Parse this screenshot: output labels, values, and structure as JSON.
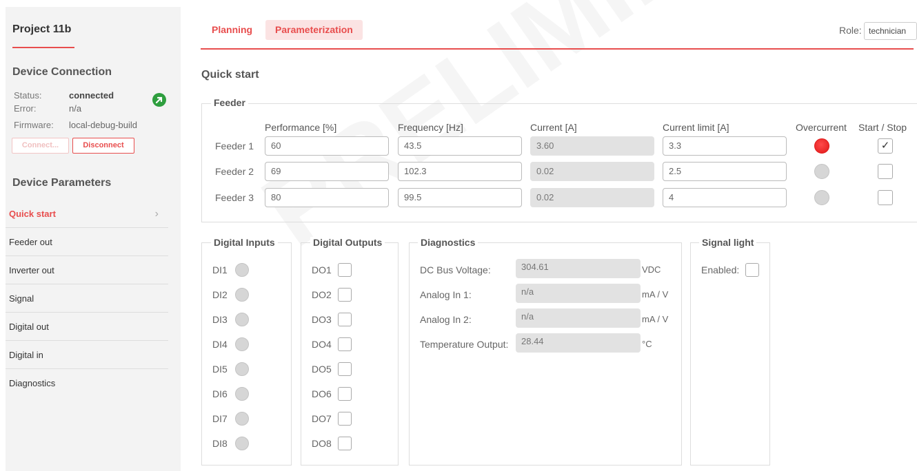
{
  "sidebar": {
    "project_title": "Project 11b",
    "connection": {
      "title": "Device Connection",
      "status_label": "Status:",
      "status_value": "connected",
      "error_label": "Error:",
      "error_value": "n/a",
      "firmware_label": "Firmware:",
      "firmware_value": "local-debug-build",
      "connect_label": "Connect...",
      "disconnect_label": "Disconnect",
      "status_color": "#2e9e3e"
    },
    "params_title": "Device Parameters",
    "items": [
      {
        "label": "Quick start"
      },
      {
        "label": "Feeder out"
      },
      {
        "label": "Inverter out"
      },
      {
        "label": "Signal"
      },
      {
        "label": "Digital out"
      },
      {
        "label": "Digital in"
      },
      {
        "label": "Diagnostics"
      }
    ]
  },
  "header": {
    "tabs": [
      {
        "label": "Planning"
      },
      {
        "label": "Parameterization"
      }
    ],
    "role_label": "Role:",
    "role_value": "technician"
  },
  "main": {
    "title": "Quick start",
    "feeder": {
      "legend": "Feeder",
      "columns": [
        "Performance [%]",
        "Frequency [Hz]",
        "Current [A]",
        "Current limit [A]",
        "Overcurrent",
        "Start / Stop"
      ],
      "rows": [
        {
          "label": "Feeder 1",
          "performance": "60",
          "frequency": "43.5",
          "current": "3.60",
          "limit": "3.3",
          "overcurrent": true,
          "running": true,
          "check": "✓"
        },
        {
          "label": "Feeder 2",
          "performance": "69",
          "frequency": "102.3",
          "current": "0.02",
          "limit": "2.5",
          "overcurrent": false,
          "running": false,
          "check": ""
        },
        {
          "label": "Feeder 3",
          "performance": "80",
          "frequency": "99.5",
          "current": "0.02",
          "limit": "4",
          "overcurrent": false,
          "running": false,
          "check": ""
        }
      ]
    },
    "digital_inputs": {
      "legend": "Digital Inputs",
      "items": [
        "DI1",
        "DI2",
        "DI3",
        "DI4",
        "DI5",
        "DI6",
        "DI7",
        "DI8"
      ]
    },
    "digital_outputs": {
      "legend": "Digital Outputs",
      "items": [
        "DO1",
        "DO2",
        "DO3",
        "DO4",
        "DO5",
        "DO6",
        "DO7",
        "DO8"
      ]
    },
    "diagnostics": {
      "legend": "Diagnostics",
      "rows": [
        {
          "label": "DC Bus Voltage:",
          "value": "304.61",
          "unit": "VDC"
        },
        {
          "label": "Analog In 1:",
          "value": "n/a",
          "unit": "mA / V"
        },
        {
          "label": "Analog In 2:",
          "value": "n/a",
          "unit": "mA / V"
        },
        {
          "label": "Temperature Output:",
          "value": "28.44",
          "unit": "°C"
        }
      ]
    },
    "signal_light": {
      "legend": "Signal light",
      "enabled_label": "Enabled:"
    }
  },
  "watermark": "PRELIMINARY",
  "colors": {
    "accent": "#e84d4d",
    "tab_active_bg": "#fbe3e3",
    "sidebar_bg": "#f3f3f3",
    "led_on": "#e01818",
    "led_off": "#d6d6d6"
  }
}
